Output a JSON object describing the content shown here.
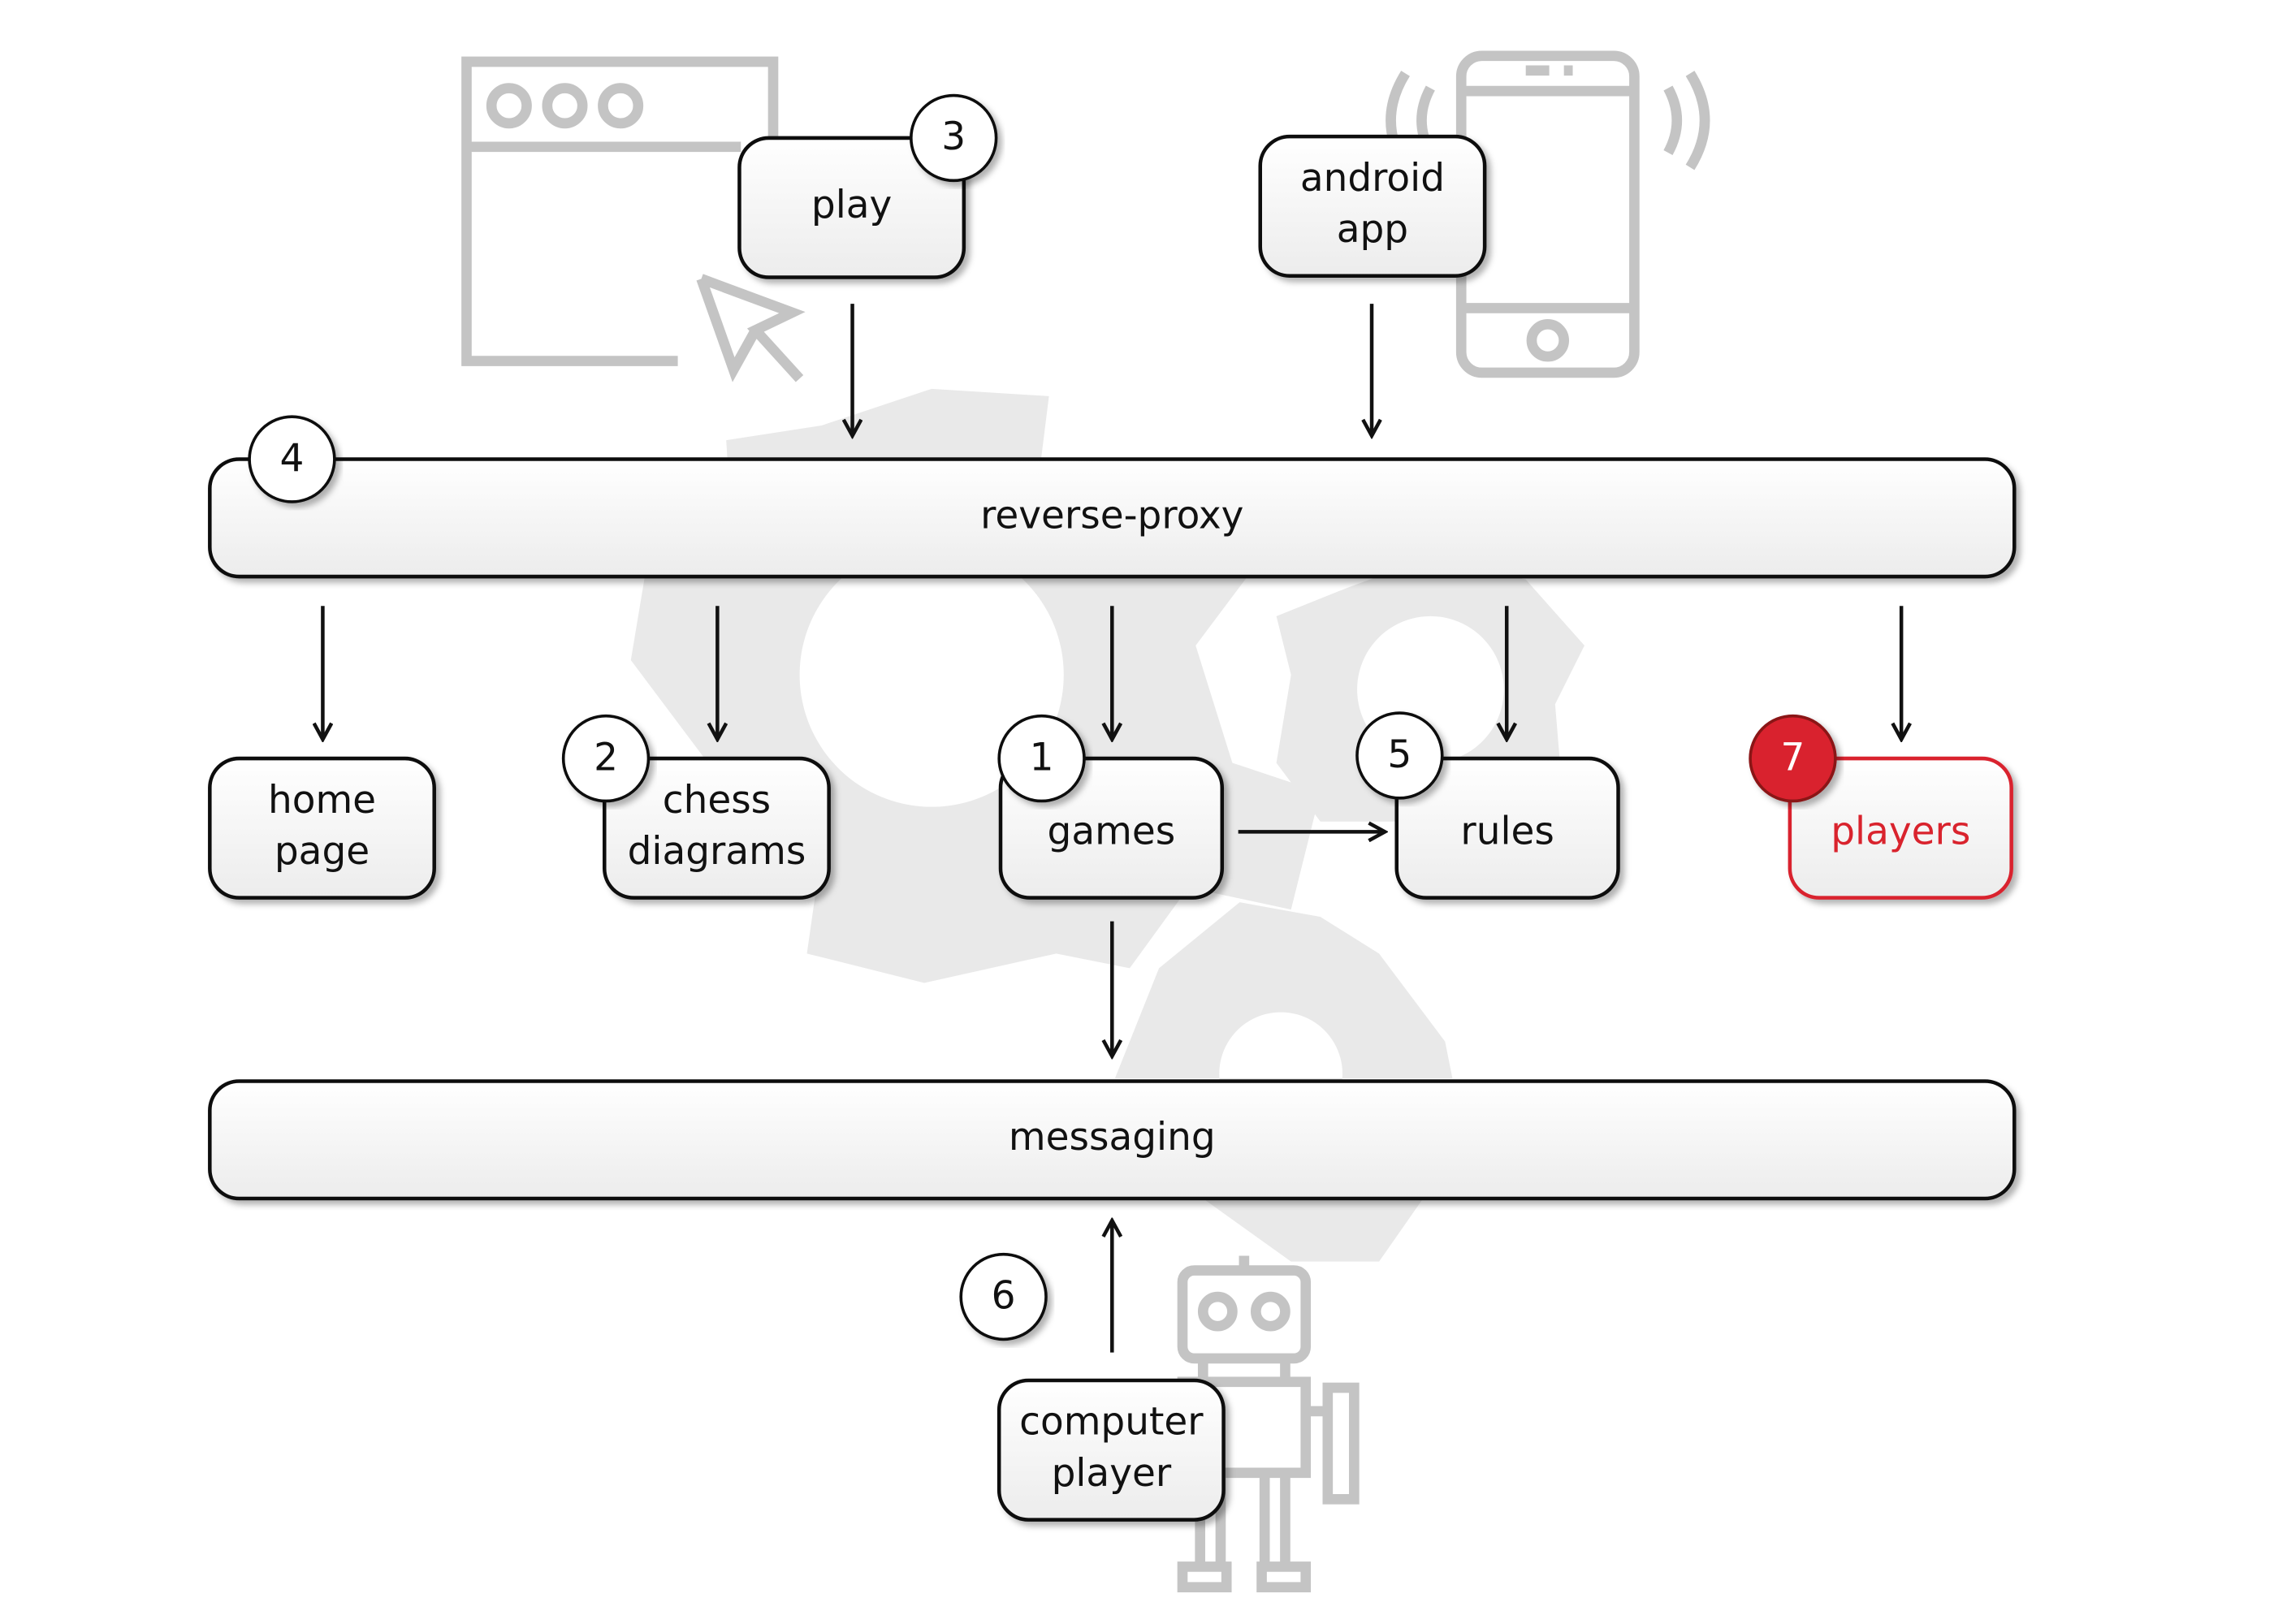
{
  "colors": {
    "accent": "#d9232d",
    "icon": "#c4c4c4",
    "gear": "#e9e9e9",
    "stroke": "#111111"
  },
  "icons": [
    "browser-window-icon",
    "cursor-icon",
    "smartphone-icon",
    "robot-icon",
    "gear-icon"
  ],
  "nodes": {
    "play": {
      "label": [
        "play"
      ],
      "badge": "3"
    },
    "android": {
      "label": [
        "android",
        "app"
      ]
    },
    "reverse_proxy": {
      "label": [
        "reverse-proxy"
      ],
      "badge": "4"
    },
    "home": {
      "label": [
        "home",
        "page"
      ]
    },
    "chess": {
      "label": [
        "chess",
        "diagrams"
      ],
      "badge": "2"
    },
    "games": {
      "label": [
        "games"
      ],
      "badge": "1"
    },
    "rules": {
      "label": [
        "rules"
      ],
      "badge": "5"
    },
    "players": {
      "label": [
        "players"
      ],
      "badge": "7",
      "highlighted": true
    },
    "messaging": {
      "label": [
        "messaging"
      ]
    },
    "computer": {
      "label": [
        "computer",
        "player"
      ],
      "badge": "6"
    }
  },
  "edges": [
    [
      "play",
      "reverse_proxy"
    ],
    [
      "android",
      "reverse_proxy"
    ],
    [
      "reverse_proxy",
      "home"
    ],
    [
      "reverse_proxy",
      "chess"
    ],
    [
      "reverse_proxy",
      "games"
    ],
    [
      "reverse_proxy",
      "rules"
    ],
    [
      "reverse_proxy",
      "players"
    ],
    [
      "games",
      "rules"
    ],
    [
      "games",
      "messaging"
    ],
    [
      "computer",
      "messaging"
    ]
  ]
}
